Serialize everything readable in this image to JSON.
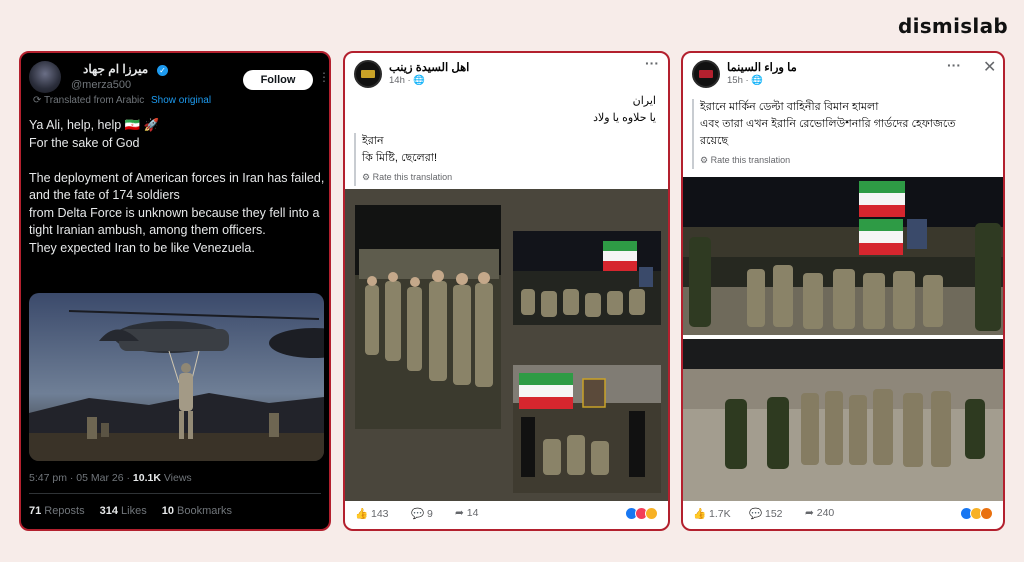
{
  "brand": "dismislab",
  "x_post": {
    "display_name": "ميرزا ام جهاد",
    "handle": "@merza500",
    "follow_label": "Follow",
    "translated_note": "Translated from Arabic",
    "show_original": "Show original",
    "text": "Ya Ali, help, help 🇮🇷 🚀\nFor the sake of God\n\nThe deployment of American forces in Iran has failed, and the fate of 174 soldiers\nfrom Delta Force is unknown because they fell into a tight Iranian ambush, among them officers.\nThey expected Iran to be like Venezuela.",
    "timestamp": "5:47 pm · 05 Mar 26 ·",
    "views_count": "10.1K",
    "views_label": "Views",
    "reposts_count": "71",
    "reposts_label": "Reposts",
    "likes_count": "314",
    "likes_label": "Likes",
    "bookmarks_count": "10",
    "bookmarks_label": "Bookmarks"
  },
  "fb_post_1": {
    "page_name": "اهل السيدة زينب",
    "time": "14h ·",
    "original_text": "ايران\nيا حلاوه يا ولاد",
    "translation": "ইরান\nকি মিষ্টি, ছেলেরা!",
    "rate_label": "Rate this translation",
    "reactions_count": "143",
    "comments_count": "9",
    "shares_count": "14"
  },
  "fb_post_2": {
    "page_name": "ما وراء السينما",
    "time": "15h ·",
    "translation": "ইরানে মার্কিন ডেল্টা বাহিনীর বিমান হামলা\nএবং তারা এখন ইরানি রেভোলিউশনারি গার্ডদের হেফাজতে\nরয়েছে",
    "rate_label": "Rate this translation",
    "reactions_count": "1.7K",
    "comments_count": "152",
    "shares_count": "240"
  },
  "colors": {
    "card_border": "#b3202e",
    "x_background": "#000000",
    "x_link": "#1d9bf0",
    "fb_media_background": "#4a463c"
  }
}
